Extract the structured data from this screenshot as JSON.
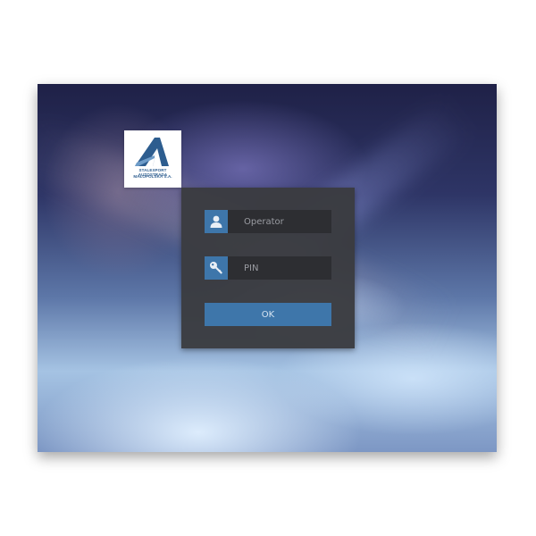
{
  "logo": {
    "line1": "STALEXPORT AUTOSTRADA",
    "line2": "MAŁOPOLSKA S.A."
  },
  "login": {
    "operator": {
      "icon": "user-icon",
      "placeholder": "Operator"
    },
    "pin": {
      "icon": "key-icon",
      "placeholder": "PIN"
    },
    "ok_label": "OK"
  },
  "colors": {
    "accent": "#3e76aa",
    "panel": "#3a3b40",
    "input": "#2d2e32"
  }
}
